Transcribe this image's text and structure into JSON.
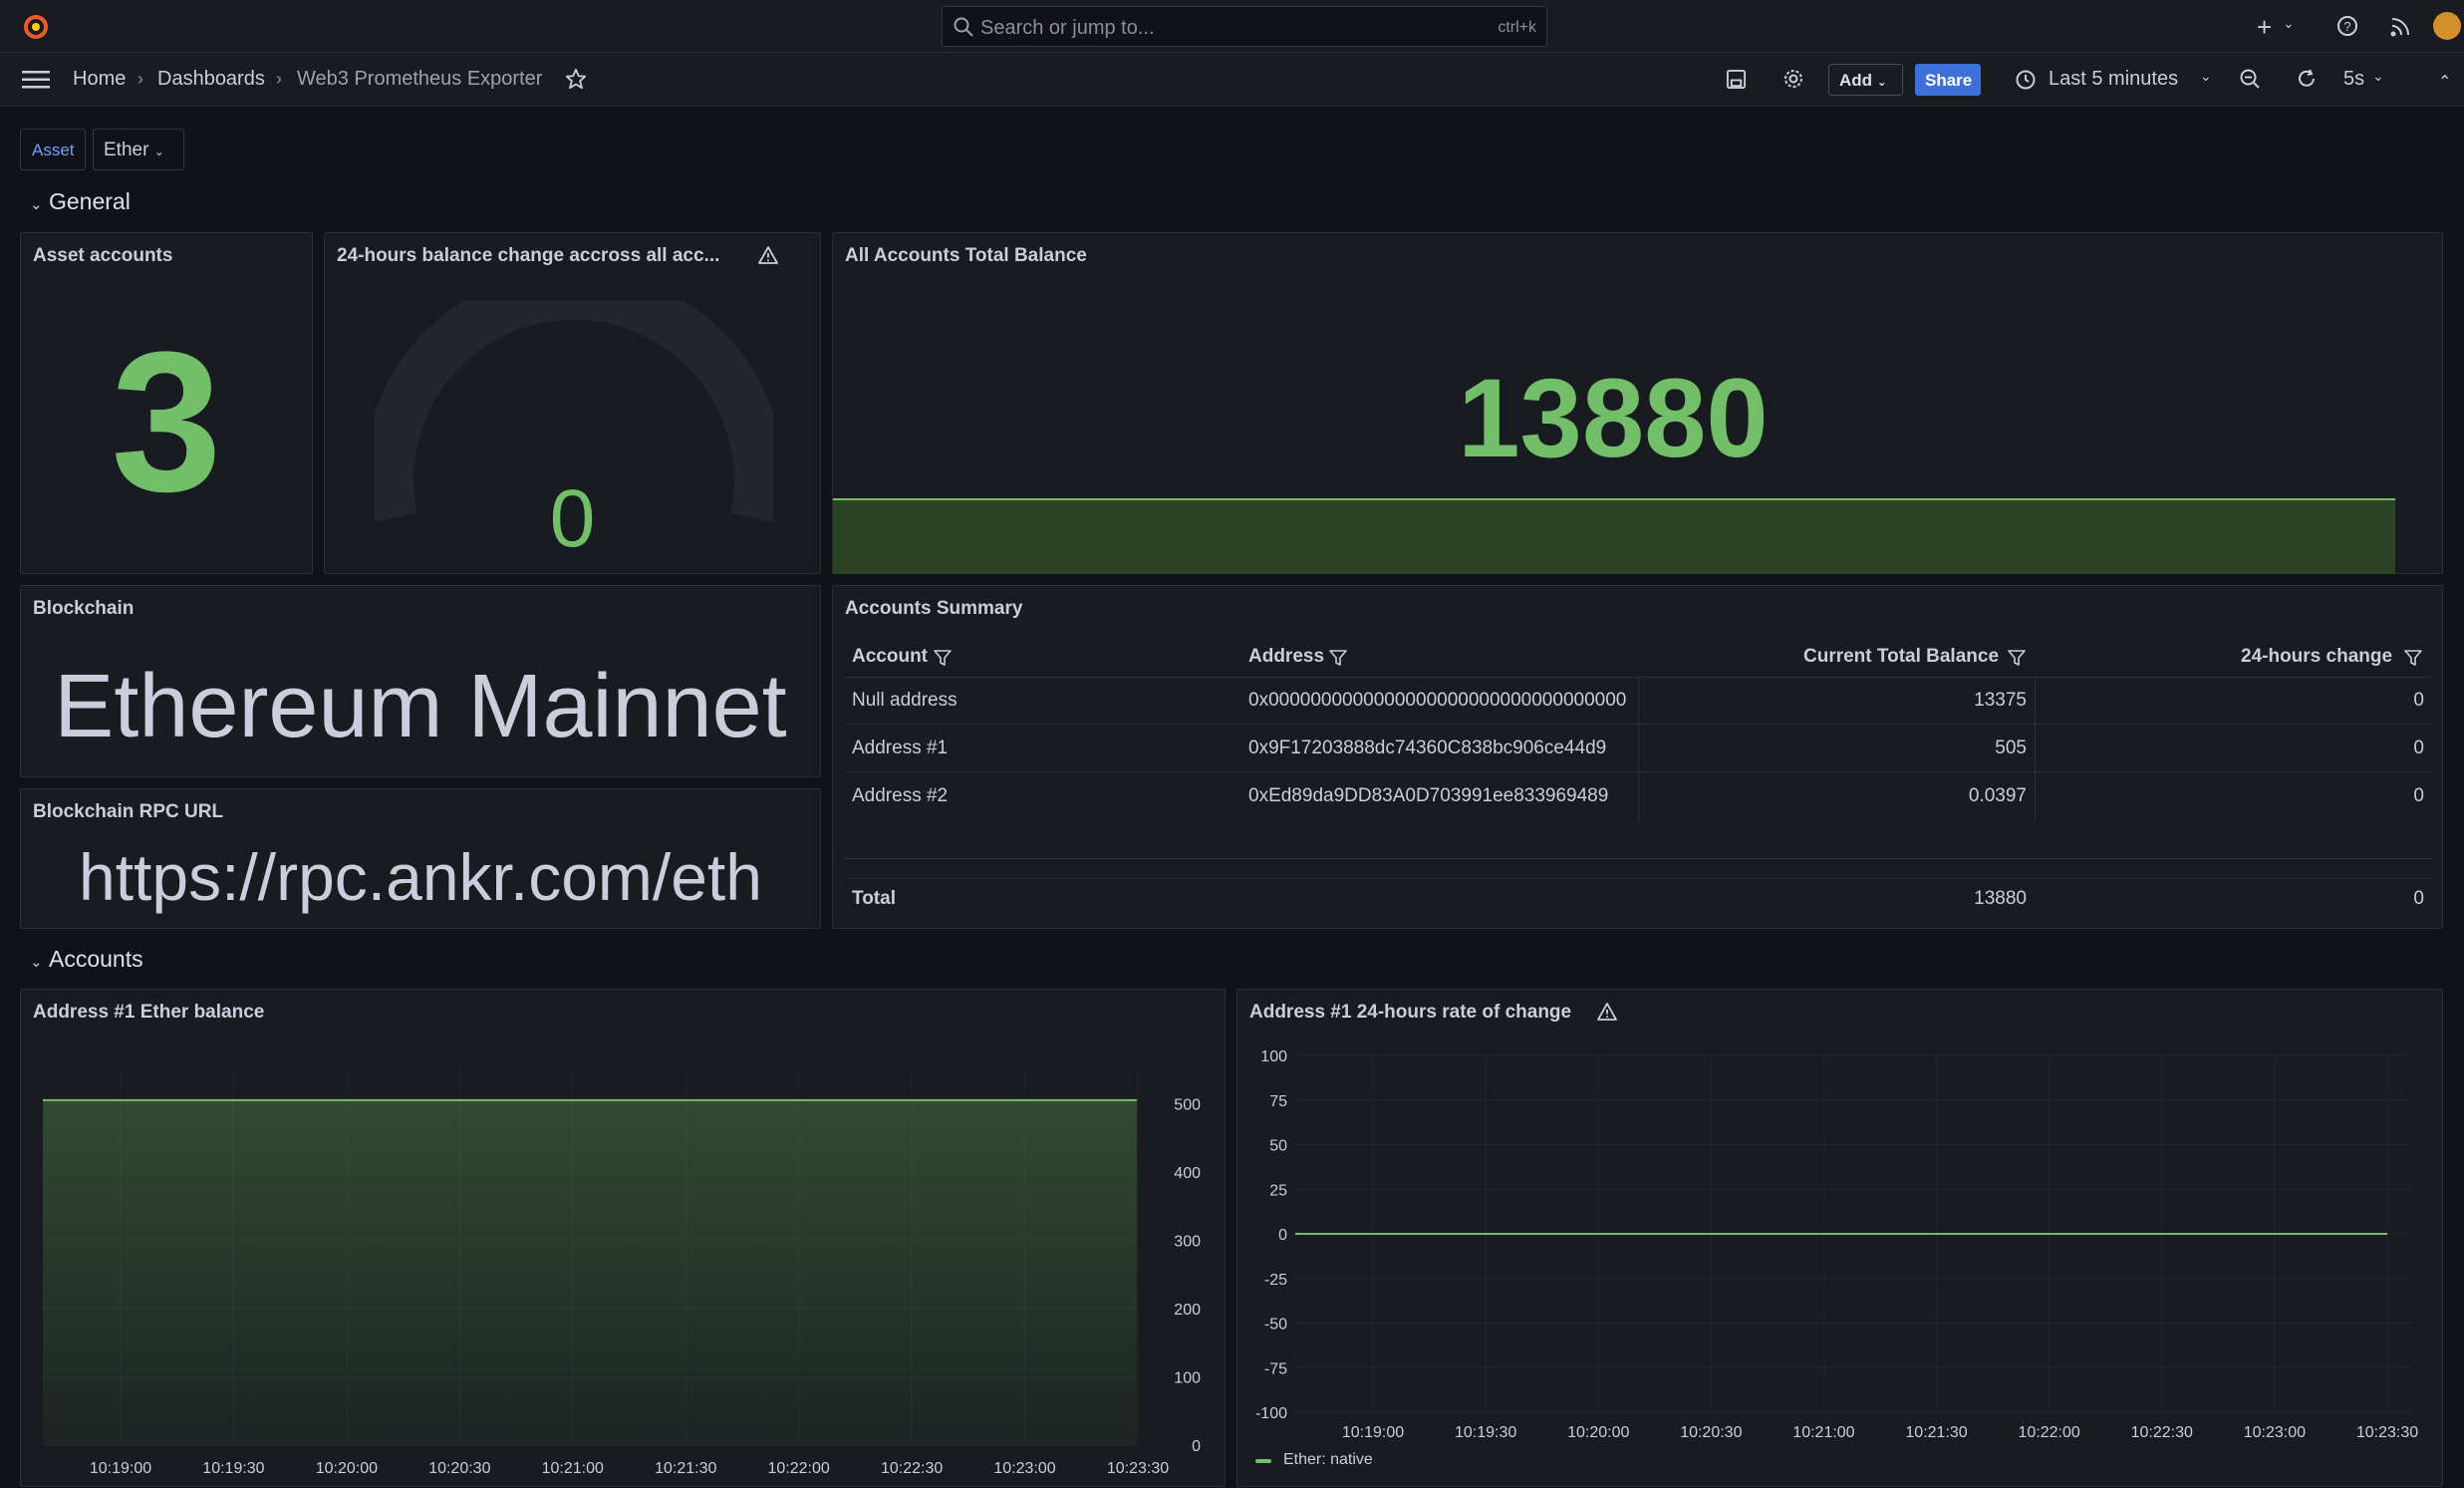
{
  "topbar": {
    "search_placeholder": "Search or jump to...",
    "search_shortcut": "ctrl+k"
  },
  "breadcrumb": [
    "Home",
    "Dashboards",
    "Web3 Prometheus Exporter"
  ],
  "toolbar": {
    "add_label": "Add",
    "share_label": "Share",
    "time_range": "Last 5 minutes",
    "refresh_interval": "5s"
  },
  "variables": {
    "asset_label": "Asset",
    "asset_value": "Ether"
  },
  "rows": {
    "general": "General",
    "accounts": "Accounts"
  },
  "panels": {
    "asset_accounts": {
      "title": "Asset accounts",
      "value": "3"
    },
    "balance_change": {
      "title": "24-hours balance change accross all acc...",
      "value": "0"
    },
    "total_balance": {
      "title": "All Accounts Total Balance",
      "value": "13880"
    },
    "blockchain": {
      "title": "Blockchain",
      "value": "Ethereum Mainnet"
    },
    "rpc_url": {
      "title": "Blockchain RPC URL",
      "value": "https://rpc.ankr.com/eth"
    },
    "accounts_summary": {
      "title": "Accounts Summary",
      "columns": [
        "Account",
        "Address",
        "Current Total Balance",
        "24-hours change"
      ],
      "rows": [
        [
          "Null address",
          "0x0000000000000000000000000000000000",
          "13375",
          "0"
        ],
        [
          "Address #1",
          "0x9F17203888dc74360C838bc906ce44d9",
          "505",
          "0"
        ],
        [
          "Address #2",
          "0xEd89da9DD83A0D703991ee833969489",
          "0.0397",
          "0"
        ]
      ],
      "footer": [
        "Total",
        "13880",
        "0"
      ]
    },
    "ether_balance": {
      "title": "Address #1 Ether balance",
      "yticks": [
        "500",
        "400",
        "300",
        "200",
        "100",
        "0"
      ],
      "xticks": [
        "10:19:00",
        "10:19:30",
        "10:20:00",
        "10:20:30",
        "10:21:00",
        "10:21:30",
        "10:22:00",
        "10:22:30",
        "10:23:00",
        "10:23:30"
      ]
    },
    "rate_of_change": {
      "title": "Address #1 24-hours rate of change",
      "yticks": [
        "100",
        "75",
        "50",
        "25",
        "0",
        "-25",
        "-50",
        "-75",
        "-100"
      ],
      "xticks": [
        "10:19:00",
        "10:19:30",
        "10:20:00",
        "10:20:30",
        "10:21:00",
        "10:21:30",
        "10:22:00",
        "10:22:30",
        "10:23:00",
        "10:23:30"
      ],
      "legend": "Ether: native"
    }
  },
  "colors": {
    "accent_green": "#73bf69",
    "primary_blue": "#3d71d9",
    "background": "#111217",
    "panel": "#181b1f"
  },
  "chart_data": [
    {
      "type": "area",
      "title": "Address #1 Ether balance",
      "x": [
        "10:19:00",
        "10:19:30",
        "10:20:00",
        "10:20:30",
        "10:21:00",
        "10:21:30",
        "10:22:00",
        "10:22:30",
        "10:23:00",
        "10:23:30"
      ],
      "series": [
        {
          "values": [
            505,
            505,
            505,
            505,
            505,
            505,
            505,
            505,
            505,
            505
          ]
        }
      ],
      "ylim": [
        0,
        550
      ]
    },
    {
      "type": "line",
      "title": "Address #1 24-hours rate of change",
      "x": [
        "10:19:00",
        "10:19:30",
        "10:20:00",
        "10:20:30",
        "10:21:00",
        "10:21:30",
        "10:22:00",
        "10:22:30",
        "10:23:00",
        "10:23:30"
      ],
      "series": [
        {
          "name": "Ether: native",
          "values": [
            0,
            0,
            0,
            0,
            0,
            0,
            0,
            0,
            0,
            0
          ]
        }
      ],
      "ylim": [
        -100,
        100
      ]
    }
  ]
}
